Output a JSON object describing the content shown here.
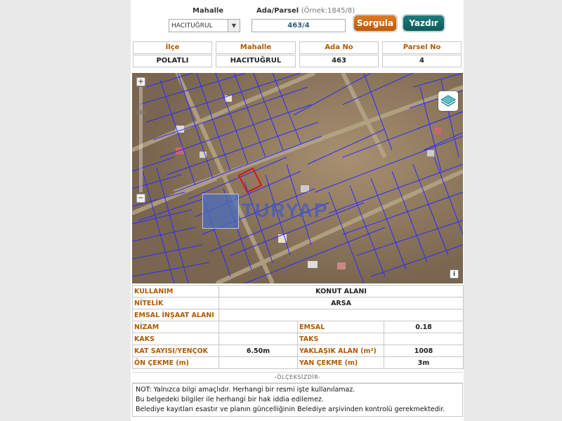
{
  "search": {
    "mahalle_label": "Mahalle",
    "ada_parsel_label": "Ada/Parsel",
    "ada_parsel_hint": "(Örnek:1845/8)",
    "mahalle_value": "HACITUĞRUL",
    "ada_parsel_value": "463/4",
    "sorgula_label": "Sorgula",
    "yazdir_label": "Yazdır"
  },
  "info": {
    "headers": [
      "İlçe",
      "Mahalle",
      "Ada No",
      "Parsel No"
    ],
    "values": [
      "POLATLI",
      "HACITUĞRUL",
      "463",
      "4"
    ]
  },
  "map": {
    "zoom_in": "+",
    "zoom_out": "−",
    "info_icon": "i",
    "watermark": "TURYAP",
    "layers_icon": "layers-icon",
    "parcel_outline_color": "#e01010",
    "cadastre_line_color": "#2a2aff"
  },
  "props": {
    "kullanim_label": "KULLANIM",
    "kullanim_value": "KONUT ALANI",
    "nitelik_label": "NİTELİK",
    "nitelik_value": "ARSA",
    "emsal_insaat_label": "EMSAL İNŞAAT ALANI",
    "emsal_insaat_value": "",
    "nizam_label": "NİZAM",
    "nizam_value": "",
    "emsal_label": "EMSAL",
    "emsal_value": "0.18",
    "kaks_label": "KAKS",
    "kaks_value": "",
    "taks_label": "TAKS",
    "taks_value": "",
    "kat_label": "KAT SAYISI/YENÇOK",
    "kat_value": "6.50m",
    "alan_label": "YAKLAŞIK ALAN (m²)",
    "alan_value": "1008",
    "on_cekme_label": "ÖN ÇEKME (m)",
    "on_cekme_value": "",
    "yan_cekme_label": "YAN ÇEKME (m)",
    "yan_cekme_value": "3m"
  },
  "scale_text": "-ÖLÇEKSİZDİR-",
  "note": {
    "line1": "NOT: Yalnızca bilgi amaçlıdır. Herhangi bir resmi işte kullanılamaz.",
    "line2": "Bu belgedeki bilgiler ile herhangi bir hak iddia edilemez.",
    "line3": "Belediye kayıtları esastır ve planın güncelliğinin Belediye arşivinden kontrolü gerekmektedir."
  }
}
